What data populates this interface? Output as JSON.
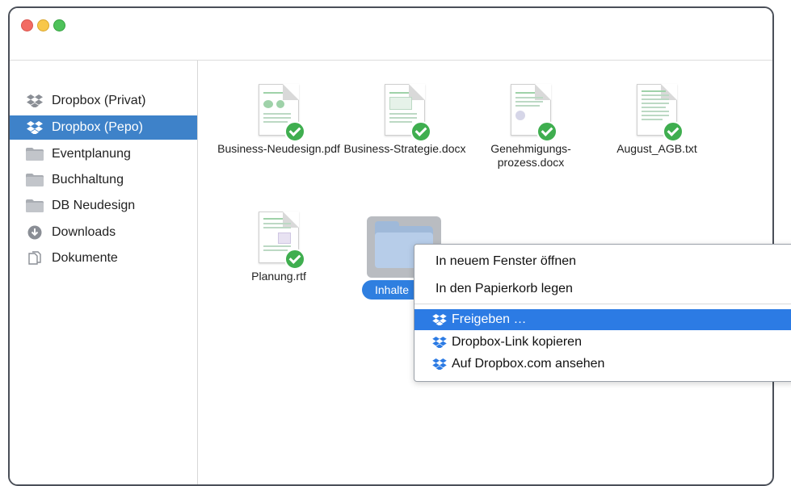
{
  "sidebar": {
    "items": [
      {
        "label": "Dropbox (Privat)",
        "icon": "dropbox-icon",
        "selected": false
      },
      {
        "label": "Dropbox (Pepo)",
        "icon": "dropbox-icon",
        "selected": true
      },
      {
        "label": "Eventplanung",
        "icon": "folder-icon",
        "selected": false
      },
      {
        "label": "Buchhaltung",
        "icon": "folder-icon",
        "selected": false
      },
      {
        "label": "DB Neudesign",
        "icon": "folder-icon",
        "selected": false
      },
      {
        "label": "Downloads",
        "icon": "download-icon",
        "selected": false
      },
      {
        "label": "Dokumente",
        "icon": "documents-icon",
        "selected": false
      }
    ]
  },
  "files": [
    {
      "name": "Business-Neudesign.pdf",
      "status": "synced"
    },
    {
      "name": "Business-Strategie.docx",
      "status": "synced"
    },
    {
      "name": "Genehmigungs-prozess.docx",
      "name_line1": "Genehmigungs-",
      "name_line2": "prozess.docx",
      "status": "synced"
    },
    {
      "name": "August_AGB.txt",
      "status": "synced"
    },
    {
      "name": "Planung.rtf",
      "status": "synced"
    }
  ],
  "folder": {
    "name": "Inhalte",
    "selected": true
  },
  "context_menu": {
    "items": [
      {
        "label": "In neuem Fenster öffnen"
      },
      {
        "label": "In den Papierkorb legen"
      },
      {
        "label": "Freigeben …",
        "icon": "dropbox-icon",
        "highlighted": true
      },
      {
        "label": "Dropbox-Link kopieren",
        "icon": "dropbox-icon"
      },
      {
        "label": "Auf Dropbox.com ansehen",
        "icon": "dropbox-icon"
      }
    ]
  },
  "colors": {
    "selection": "#3e82c9",
    "menu_highlight": "#2c7be4",
    "sync_check": "#3fae4f",
    "dropbox_blue": "#0061fe"
  }
}
